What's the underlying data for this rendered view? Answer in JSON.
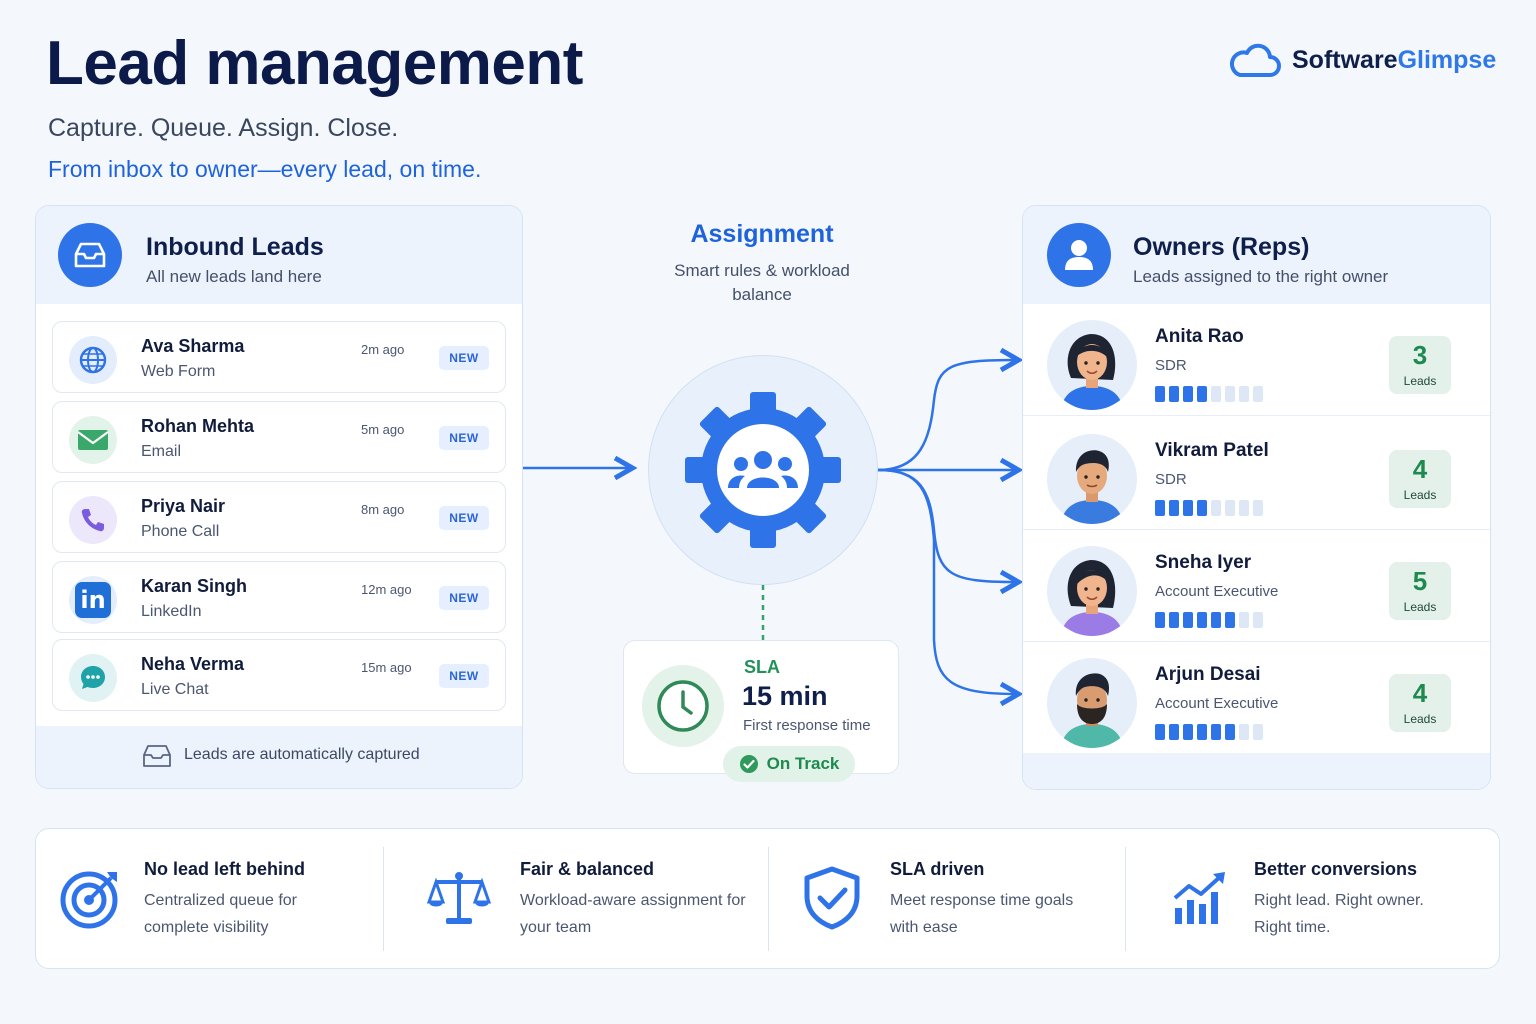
{
  "header": {
    "title": "Lead management",
    "subtitle": "Capture. Queue. Assign. Close.",
    "tagline": "From inbox to owner—every lead, on time.",
    "brand": {
      "name_part1": "Software",
      "name_part2": "Glimpse",
      "icon": "cloud-icon"
    }
  },
  "inbound": {
    "title": "Inbound Leads",
    "subtitle": "All new leads land here",
    "icon": "inbox-icon",
    "footer": "Leads are automatically captured",
    "leads": [
      {
        "name": "Ava Sharma",
        "source": "Web Form",
        "time": "2m ago",
        "badge": "NEW",
        "icon": "globe-icon"
      },
      {
        "name": "Rohan Mehta",
        "source": "Email",
        "time": "5m ago",
        "badge": "NEW",
        "icon": "envelope-icon"
      },
      {
        "name": "Priya Nair",
        "source": "Phone Call",
        "time": "8m ago",
        "badge": "NEW",
        "icon": "phone-icon"
      },
      {
        "name": "Karan Singh",
        "source": "LinkedIn",
        "time": "12m ago",
        "badge": "NEW",
        "icon": "linkedin-icon"
      },
      {
        "name": "Neha Verma",
        "source": "Live Chat",
        "time": "15m ago",
        "badge": "NEW",
        "icon": "chat-icon"
      }
    ]
  },
  "assignment": {
    "title": "Assignment",
    "subtitle": "Smart rules & workload balance",
    "icon": "gear-team-icon"
  },
  "sla": {
    "label": "SLA",
    "value": "15 min",
    "description": "First response time",
    "status": "On Track",
    "icon": "clock-icon"
  },
  "owners": {
    "title": "Owners (Reps)",
    "subtitle": "Leads assigned to the right owner",
    "icon": "user-icon",
    "reps": [
      {
        "name": "Anita Rao",
        "role": "SDR",
        "count": "3",
        "count_label": "Leads",
        "load": 0.55
      },
      {
        "name": "Vikram Patel",
        "role": "SDR",
        "count": "4",
        "count_label": "Leads",
        "load": 0.5
      },
      {
        "name": "Sneha Iyer",
        "role": "Account Executive",
        "count": "5",
        "count_label": "Leads",
        "load": 0.8
      },
      {
        "name": "Arjun Desai",
        "role": "Account Executive",
        "count": "4",
        "count_label": "Leads",
        "load": 0.7
      }
    ]
  },
  "features": [
    {
      "title": "No lead left behind",
      "desc": "Centralized queue for complete visibility",
      "icon": "target-icon"
    },
    {
      "title": "Fair & balanced",
      "desc": "Workload-aware assignment for your team",
      "icon": "scale-icon"
    },
    {
      "title": "SLA driven",
      "desc": "Meet response time goals with ease",
      "icon": "shield-check-icon"
    },
    {
      "title": "Better conversions",
      "desc": "Right lead. Right owner. Right time.",
      "icon": "growth-chart-icon"
    }
  ],
  "colors": {
    "accent": "#2f73e8",
    "success": "#1f8a50",
    "title": "#0c1a4a"
  }
}
